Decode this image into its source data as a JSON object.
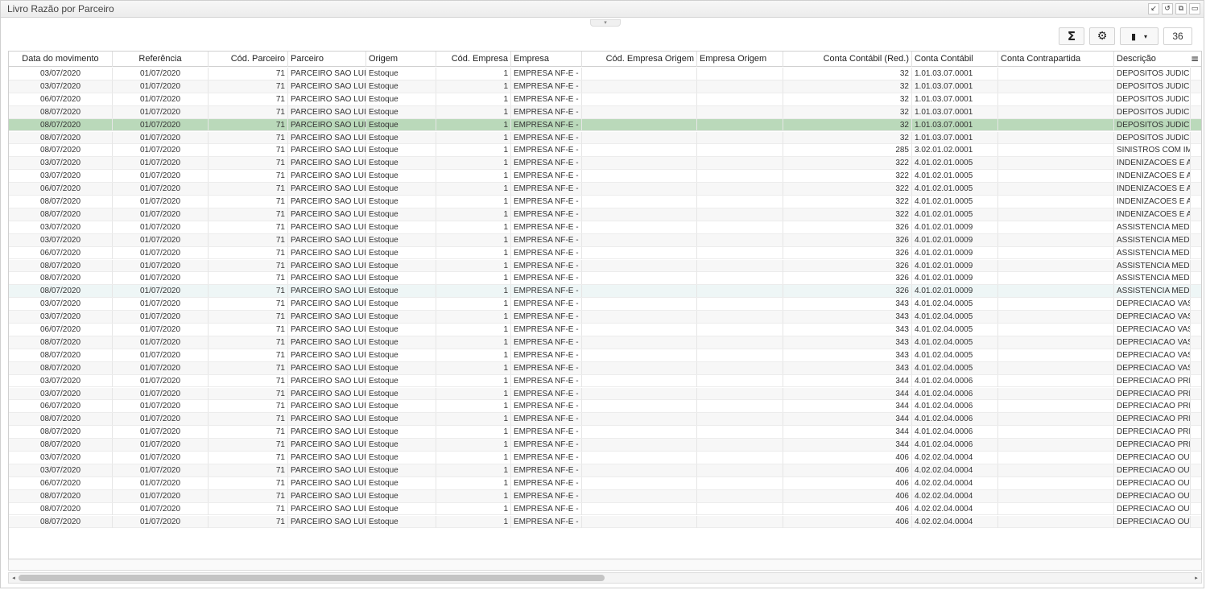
{
  "window": {
    "title": "Livro Razão por Parceiro",
    "controls": [
      "↙",
      "↺",
      "⧉",
      "▭"
    ]
  },
  "toolbar": {
    "sum_icon": "Σ",
    "settings_icon": "⚙",
    "export_icon": "▮",
    "dropdown_icon": "▾",
    "record_count": "36"
  },
  "grid": {
    "columns": [
      {
        "label": "Data do movimento",
        "align": "c"
      },
      {
        "label": "Referência",
        "align": "c"
      },
      {
        "label": "Cód. Parceiro",
        "align": "r"
      },
      {
        "label": "Parceiro",
        "align": "l"
      },
      {
        "label": "Origem",
        "align": "l"
      },
      {
        "label": "Cód. Empresa",
        "align": "r"
      },
      {
        "label": "Empresa",
        "align": "l"
      },
      {
        "label": "Cód. Empresa Origem",
        "align": "r"
      },
      {
        "label": "Empresa Origem",
        "align": "l"
      },
      {
        "label": "Conta Contábil (Red.)",
        "align": "r"
      },
      {
        "label": "Conta Contábil",
        "align": "l"
      },
      {
        "label": "Conta Contrapartida",
        "align": "l"
      },
      {
        "label": "Descrição",
        "align": "l"
      }
    ],
    "rows": [
      [
        "03/07/2020",
        "01/07/2020",
        "71",
        "PARCEIRO SAO LUIS",
        "Estoque",
        "1",
        "EMPRESA NF-E - M",
        "",
        "",
        "32",
        "1.01.03.07.0001",
        "",
        "DEPOSITOS JUDICIAIS"
      ],
      [
        "03/07/2020",
        "01/07/2020",
        "71",
        "PARCEIRO SAO LUIS",
        "Estoque",
        "1",
        "EMPRESA NF-E - M",
        "",
        "",
        "32",
        "1.01.03.07.0001",
        "",
        "DEPOSITOS JUDICIAIS"
      ],
      [
        "06/07/2020",
        "01/07/2020",
        "71",
        "PARCEIRO SAO LUIS",
        "Estoque",
        "1",
        "EMPRESA NF-E - M",
        "",
        "",
        "32",
        "1.01.03.07.0001",
        "",
        "DEPOSITOS JUDICIAIS"
      ],
      [
        "08/07/2020",
        "01/07/2020",
        "71",
        "PARCEIRO SAO LUIS",
        "Estoque",
        "1",
        "EMPRESA NF-E - M",
        "",
        "",
        "32",
        "1.01.03.07.0001",
        "",
        "DEPOSITOS JUDICIAIS"
      ],
      [
        "08/07/2020",
        "01/07/2020",
        "71",
        "PARCEIRO SAO LUIS",
        "Estoque",
        "1",
        "EMPRESA NF-E - M",
        "",
        "",
        "32",
        "1.01.03.07.0001",
        "",
        "DEPOSITOS JUDICIAIS"
      ],
      [
        "08/07/2020",
        "01/07/2020",
        "71",
        "PARCEIRO SAO LUIS",
        "Estoque",
        "1",
        "EMPRESA NF-E - M",
        "",
        "",
        "32",
        "1.01.03.07.0001",
        "",
        "DEPOSITOS JUDICIAIS"
      ],
      [
        "08/07/2020",
        "01/07/2020",
        "71",
        "PARCEIRO SAO LUIS",
        "Estoque",
        "1",
        "EMPRESA NF-E - M",
        "",
        "",
        "285",
        "3.02.01.02.0001",
        "",
        "SINISTROS COM IMOB"
      ],
      [
        "03/07/2020",
        "01/07/2020",
        "71",
        "PARCEIRO SAO LUIS",
        "Estoque",
        "1",
        "EMPRESA NF-E - M",
        "",
        "",
        "322",
        "4.01.02.01.0005",
        "",
        "INDENIZACOES E AVIS"
      ],
      [
        "03/07/2020",
        "01/07/2020",
        "71",
        "PARCEIRO SAO LUIS",
        "Estoque",
        "1",
        "EMPRESA NF-E - M",
        "",
        "",
        "322",
        "4.01.02.01.0005",
        "",
        "INDENIZACOES E AVIS"
      ],
      [
        "06/07/2020",
        "01/07/2020",
        "71",
        "PARCEIRO SAO LUIS",
        "Estoque",
        "1",
        "EMPRESA NF-E - M",
        "",
        "",
        "322",
        "4.01.02.01.0005",
        "",
        "INDENIZACOES E AVIS"
      ],
      [
        "08/07/2020",
        "01/07/2020",
        "71",
        "PARCEIRO SAO LUIS",
        "Estoque",
        "1",
        "EMPRESA NF-E - M",
        "",
        "",
        "322",
        "4.01.02.01.0005",
        "",
        "INDENIZACOES E AVIS"
      ],
      [
        "08/07/2020",
        "01/07/2020",
        "71",
        "PARCEIRO SAO LUIS",
        "Estoque",
        "1",
        "EMPRESA NF-E - M",
        "",
        "",
        "322",
        "4.01.02.01.0005",
        "",
        "INDENIZACOES E AVIS"
      ],
      [
        "03/07/2020",
        "01/07/2020",
        "71",
        "PARCEIRO SAO LUIS",
        "Estoque",
        "1",
        "EMPRESA NF-E - M",
        "",
        "",
        "326",
        "4.01.02.01.0009",
        "",
        "ASSISTENCIA MEDICA"
      ],
      [
        "03/07/2020",
        "01/07/2020",
        "71",
        "PARCEIRO SAO LUIS",
        "Estoque",
        "1",
        "EMPRESA NF-E - M",
        "",
        "",
        "326",
        "4.01.02.01.0009",
        "",
        "ASSISTENCIA MEDICA"
      ],
      [
        "06/07/2020",
        "01/07/2020",
        "71",
        "PARCEIRO SAO LUIS",
        "Estoque",
        "1",
        "EMPRESA NF-E - M",
        "",
        "",
        "326",
        "4.01.02.01.0009",
        "",
        "ASSISTENCIA MEDICA"
      ],
      [
        "08/07/2020",
        "01/07/2020",
        "71",
        "PARCEIRO SAO LUIS",
        "Estoque",
        "1",
        "EMPRESA NF-E - M",
        "",
        "",
        "326",
        "4.01.02.01.0009",
        "",
        "ASSISTENCIA MEDICA"
      ],
      [
        "08/07/2020",
        "01/07/2020",
        "71",
        "PARCEIRO SAO LUIS",
        "Estoque",
        "1",
        "EMPRESA NF-E - M",
        "",
        "",
        "326",
        "4.01.02.01.0009",
        "",
        "ASSISTENCIA MEDICA"
      ],
      [
        "08/07/2020",
        "01/07/2020",
        "71",
        "PARCEIRO SAO LUIS",
        "Estoque",
        "1",
        "EMPRESA NF-E - M",
        "",
        "",
        "326",
        "4.01.02.01.0009",
        "",
        "ASSISTENCIA MEDICA"
      ],
      [
        "03/07/2020",
        "01/07/2020",
        "71",
        "PARCEIRO SAO LUIS",
        "Estoque",
        "1",
        "EMPRESA NF-E - M",
        "",
        "",
        "343",
        "4.01.02.04.0005",
        "",
        "DEPRECIACAO VASILI"
      ],
      [
        "03/07/2020",
        "01/07/2020",
        "71",
        "PARCEIRO SAO LUIS",
        "Estoque",
        "1",
        "EMPRESA NF-E - M",
        "",
        "",
        "343",
        "4.01.02.04.0005",
        "",
        "DEPRECIACAO VASILI"
      ],
      [
        "06/07/2020",
        "01/07/2020",
        "71",
        "PARCEIRO SAO LUIS",
        "Estoque",
        "1",
        "EMPRESA NF-E - M",
        "",
        "",
        "343",
        "4.01.02.04.0005",
        "",
        "DEPRECIACAO VASILI"
      ],
      [
        "08/07/2020",
        "01/07/2020",
        "71",
        "PARCEIRO SAO LUIS",
        "Estoque",
        "1",
        "EMPRESA NF-E - M",
        "",
        "",
        "343",
        "4.01.02.04.0005",
        "",
        "DEPRECIACAO VASILI"
      ],
      [
        "08/07/2020",
        "01/07/2020",
        "71",
        "PARCEIRO SAO LUIS",
        "Estoque",
        "1",
        "EMPRESA NF-E - M",
        "",
        "",
        "343",
        "4.01.02.04.0005",
        "",
        "DEPRECIACAO VASILI"
      ],
      [
        "08/07/2020",
        "01/07/2020",
        "71",
        "PARCEIRO SAO LUIS",
        "Estoque",
        "1",
        "EMPRESA NF-E - M",
        "",
        "",
        "343",
        "4.01.02.04.0005",
        "",
        "DEPRECIACAO VASILI"
      ],
      [
        "03/07/2020",
        "01/07/2020",
        "71",
        "PARCEIRO SAO LUIS",
        "Estoque",
        "1",
        "EMPRESA NF-E - M",
        "",
        "",
        "344",
        "4.01.02.04.0006",
        "",
        "DEPRECIACAO PREDI"
      ],
      [
        "03/07/2020",
        "01/07/2020",
        "71",
        "PARCEIRO SAO LUIS",
        "Estoque",
        "1",
        "EMPRESA NF-E - M",
        "",
        "",
        "344",
        "4.01.02.04.0006",
        "",
        "DEPRECIACAO PREDI"
      ],
      [
        "06/07/2020",
        "01/07/2020",
        "71",
        "PARCEIRO SAO LUIS",
        "Estoque",
        "1",
        "EMPRESA NF-E - M",
        "",
        "",
        "344",
        "4.01.02.04.0006",
        "",
        "DEPRECIACAO PREDI"
      ],
      [
        "08/07/2020",
        "01/07/2020",
        "71",
        "PARCEIRO SAO LUIS",
        "Estoque",
        "1",
        "EMPRESA NF-E - M",
        "",
        "",
        "344",
        "4.01.02.04.0006",
        "",
        "DEPRECIACAO PREDI"
      ],
      [
        "08/07/2020",
        "01/07/2020",
        "71",
        "PARCEIRO SAO LUIS",
        "Estoque",
        "1",
        "EMPRESA NF-E - M",
        "",
        "",
        "344",
        "4.01.02.04.0006",
        "",
        "DEPRECIACAO PREDI"
      ],
      [
        "08/07/2020",
        "01/07/2020",
        "71",
        "PARCEIRO SAO LUIS",
        "Estoque",
        "1",
        "EMPRESA NF-E - M",
        "",
        "",
        "344",
        "4.01.02.04.0006",
        "",
        "DEPRECIACAO PREDI"
      ],
      [
        "03/07/2020",
        "01/07/2020",
        "71",
        "PARCEIRO SAO LUIS",
        "Estoque",
        "1",
        "EMPRESA NF-E - M",
        "",
        "",
        "406",
        "4.02.02.04.0004",
        "",
        "DEPRECIACAO OUTRA"
      ],
      [
        "03/07/2020",
        "01/07/2020",
        "71",
        "PARCEIRO SAO LUIS",
        "Estoque",
        "1",
        "EMPRESA NF-E - M",
        "",
        "",
        "406",
        "4.02.02.04.0004",
        "",
        "DEPRECIACAO OUTRA"
      ],
      [
        "06/07/2020",
        "01/07/2020",
        "71",
        "PARCEIRO SAO LUIS",
        "Estoque",
        "1",
        "EMPRESA NF-E - M",
        "",
        "",
        "406",
        "4.02.02.04.0004",
        "",
        "DEPRECIACAO OUTRA"
      ],
      [
        "08/07/2020",
        "01/07/2020",
        "71",
        "PARCEIRO SAO LUIS",
        "Estoque",
        "1",
        "EMPRESA NF-E - M",
        "",
        "",
        "406",
        "4.02.02.04.0004",
        "",
        "DEPRECIACAO OUTRA"
      ],
      [
        "08/07/2020",
        "01/07/2020",
        "71",
        "PARCEIRO SAO LUIS",
        "Estoque",
        "1",
        "EMPRESA NF-E - M",
        "",
        "",
        "406",
        "4.02.02.04.0004",
        "",
        "DEPRECIACAO OUTRA"
      ],
      [
        "08/07/2020",
        "01/07/2020",
        "71",
        "PARCEIRO SAO LUIS",
        "Estoque",
        "1",
        "EMPRESA NF-E - M",
        "",
        "",
        "406",
        "4.02.02.04.0004",
        "",
        "DEPRECIACAO OUTRA"
      ]
    ],
    "selected_row": 4,
    "hovered_row": 17,
    "selected_color": "#bad9ba",
    "menu_icon": "≡"
  },
  "scrollbar": {
    "left_arrow": "◂",
    "right_arrow": "▸"
  },
  "panel": {
    "collapse_icon": "▾"
  }
}
